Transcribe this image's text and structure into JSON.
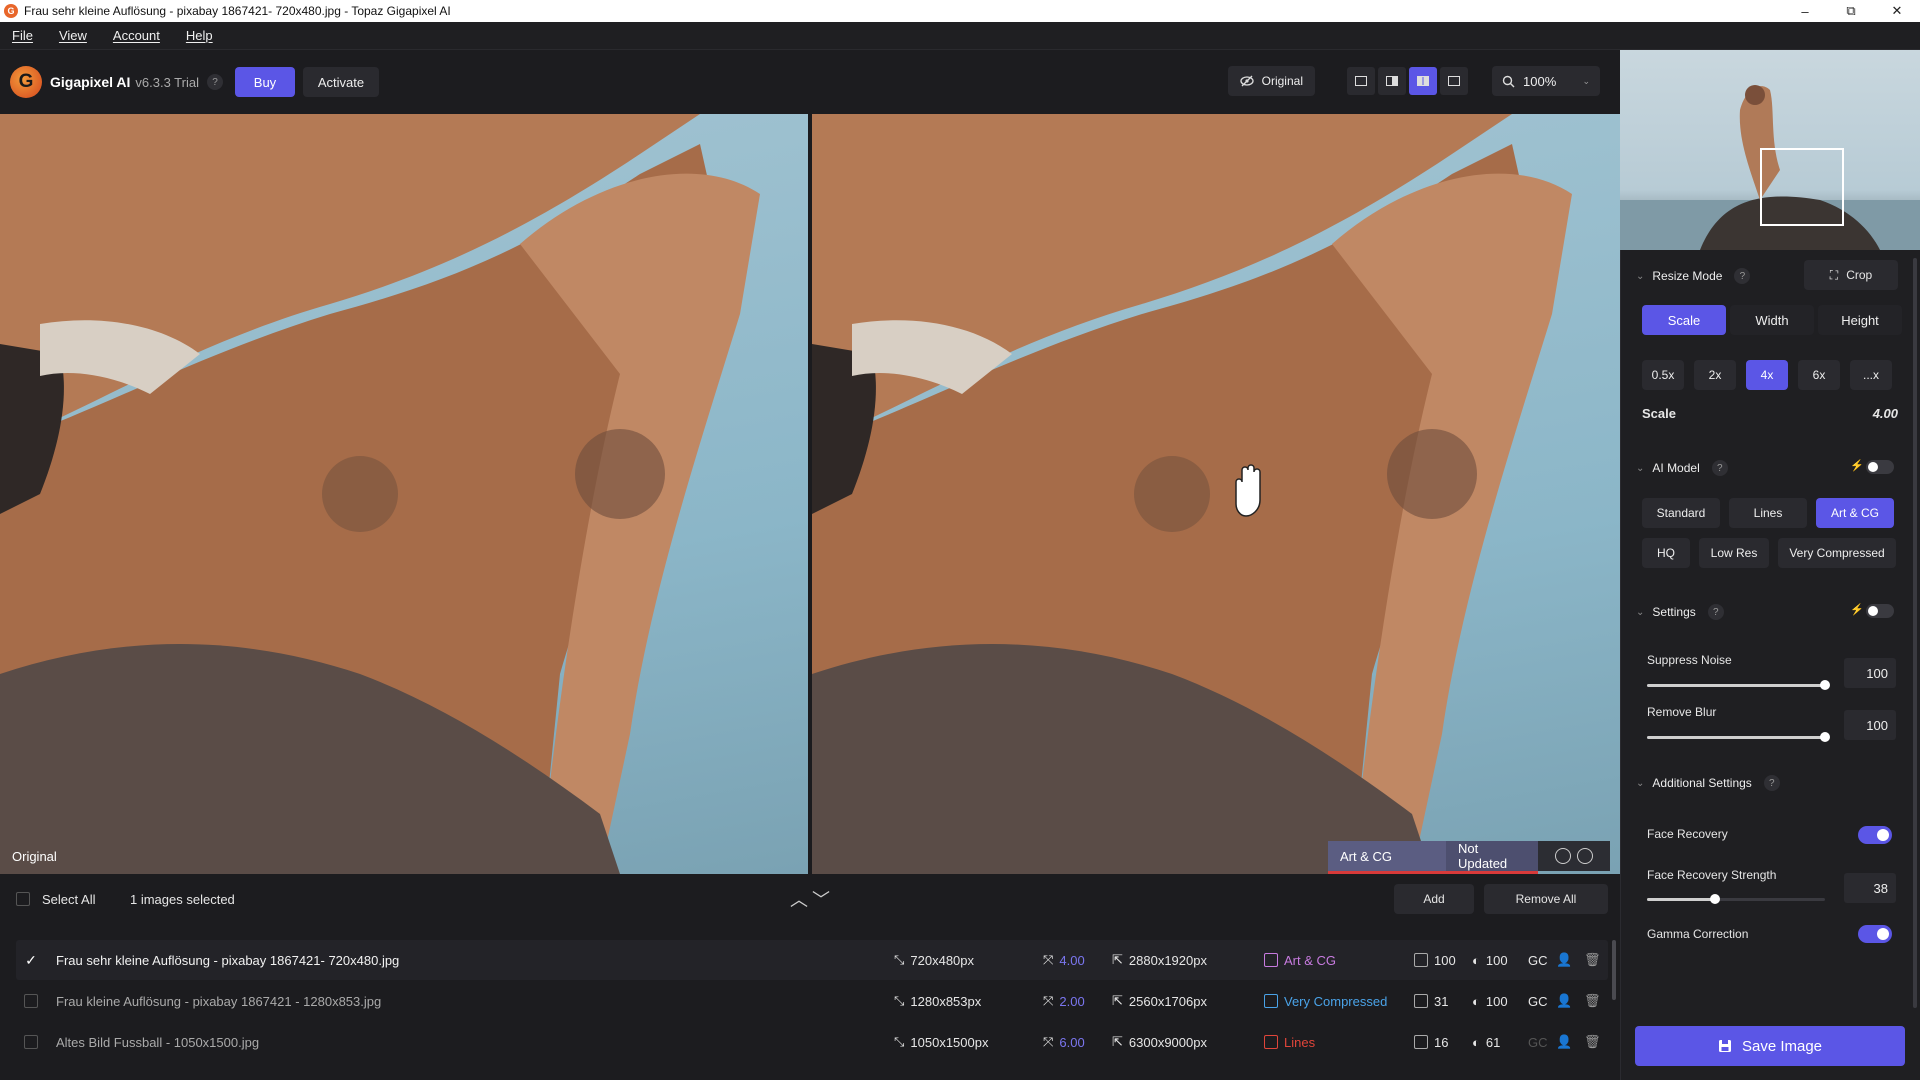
{
  "window": {
    "title": "Frau sehr kleine Auflösung - pixabay 1867421- 720x480.jpg - Topaz Gigapixel AI",
    "minimize": "–",
    "maximize": "⧉",
    "close": "✕"
  },
  "menu": [
    "File",
    "View",
    "Account",
    "Help"
  ],
  "toolbar": {
    "logo_letter": "G",
    "brand": "Gigapixel AI",
    "version": "v6.3.3 Trial",
    "help": "?",
    "buy": "Buy",
    "activate": "Activate",
    "original": "Original",
    "zoom": "100%"
  },
  "viewer": {
    "left_label": "Original",
    "model_tag": "Art & CG",
    "status_tag": "Not Updated"
  },
  "list": {
    "select_all": "Select All",
    "selected_count": "1 images selected",
    "add": "Add",
    "remove_all": "Remove All",
    "rows": [
      {
        "name": "Frau sehr kleine Auflösung - pixabay 1867421- 720x480.jpg",
        "selected": true,
        "input_size": "720x480px",
        "scale": "4.00",
        "output_size": "2880x1920px",
        "model": "Art & CG",
        "model_color": "#c87be0",
        "noise": "100",
        "blur": "100",
        "gc": "GC"
      },
      {
        "name": "Frau kleine Auflösung - pixabay 1867421 - 1280x853.jpg",
        "selected": false,
        "input_size": "1280x853px",
        "scale": "2.00",
        "output_size": "2560x1706px",
        "model": "Very Compressed",
        "model_color": "#4aa3e8",
        "noise": "31",
        "blur": "100",
        "gc": "GC"
      },
      {
        "name": "Altes Bild Fussball - 1050x1500.jpg",
        "selected": false,
        "input_size": "1050x1500px",
        "scale": "6.00",
        "output_size": "6300x9000px",
        "model": "Lines",
        "model_color": "#e0453a",
        "noise": "16",
        "blur": "61",
        "gc": "GC"
      }
    ]
  },
  "panel": {
    "resize_mode": "Resize Mode",
    "crop": "Crop",
    "modes": [
      "Scale",
      "Width",
      "Height"
    ],
    "scales": [
      "0.5x",
      "2x",
      "4x",
      "6x",
      "...x"
    ],
    "scale_label": "Scale",
    "scale_value": "4.00",
    "ai_model": "AI Model",
    "models_row1": [
      "Standard",
      "Lines",
      "Art & CG"
    ],
    "models_row2": [
      "HQ",
      "Low Res",
      "Very Compressed"
    ],
    "settings": "Settings",
    "suppress_noise": "Suppress Noise",
    "suppress_noise_value": "100",
    "suppress_noise_level": 1.0,
    "remove_blur": "Remove Blur",
    "remove_blur_value": "100",
    "remove_blur_level": 1.0,
    "additional_settings": "Additional Settings",
    "face_recovery": "Face Recovery",
    "face_recovery_strength": "Face Recovery Strength",
    "face_recovery_strength_value": "38",
    "face_recovery_strength_level": 0.38,
    "gamma_correction": "Gamma Correction",
    "save": "Save Image"
  },
  "colors": {
    "accent": "#5b56e6",
    "panel_bg": "#1f1f22"
  }
}
